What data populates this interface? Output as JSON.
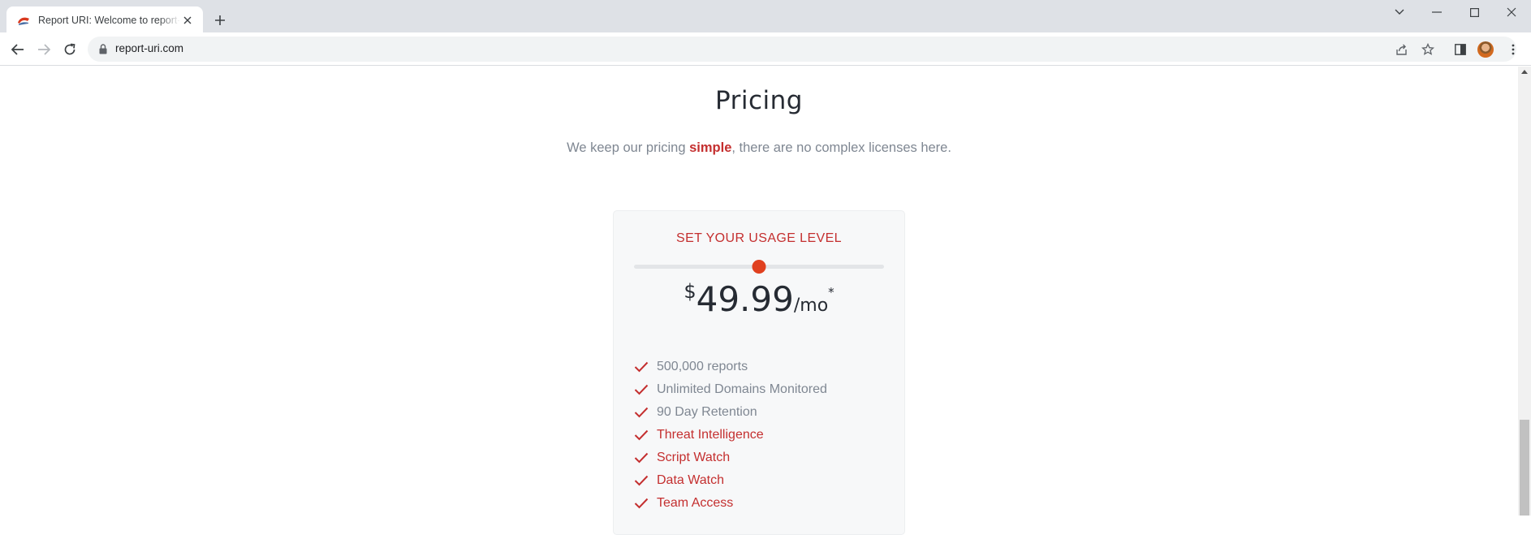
{
  "browser": {
    "tab_title": "Report URI: Welcome to report-uri",
    "url": "report-uri.com"
  },
  "colors": {
    "accent": "#e0401f",
    "brand_red": "#c42f2f",
    "muted_text": "#7f8792"
  },
  "pricing": {
    "heading": "Pricing",
    "subtitle_before": "We keep our pricing ",
    "subtitle_emphasis": "simple",
    "subtitle_after": ", there are no complex licenses here.",
    "usage_label": "SET YOUR USAGE LEVEL",
    "slider_level": 0.5,
    "currency": "$",
    "amount": "49.99",
    "period": "/mo",
    "asterisk": "*",
    "features": [
      {
        "label": "500,000 reports",
        "highlight": false
      },
      {
        "label": "Unlimited Domains Monitored",
        "highlight": false
      },
      {
        "label": "90 Day Retention",
        "highlight": false
      },
      {
        "label": "Threat Intelligence",
        "highlight": true
      },
      {
        "label": "Script Watch",
        "highlight": true
      },
      {
        "label": "Data Watch",
        "highlight": true
      },
      {
        "label": "Team Access",
        "highlight": true
      }
    ]
  }
}
